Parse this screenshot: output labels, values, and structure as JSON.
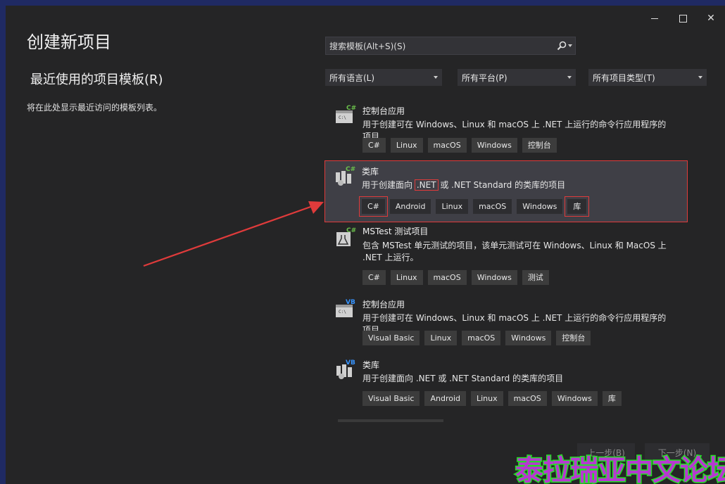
{
  "window": {
    "title": "创建新项目",
    "controls": {
      "minimize": "—",
      "maximize": "□",
      "close": "✕"
    }
  },
  "recent": {
    "heading": "最近使用的项目模板(R)",
    "empty_text": "将在此处显示最近访问的模板列表。"
  },
  "search": {
    "placeholder": "搜索模板(Alt+S)(S)",
    "icon": "search-icon"
  },
  "filters": {
    "language": "所有语言(L)",
    "platform": "所有平台(P)",
    "project_type": "所有项目类型(T)"
  },
  "templates": [
    {
      "badge": "C#",
      "icon": "console-app-icon",
      "name": "控制台应用",
      "desc": "用于创建可在 Windows、Linux 和 macOS 上 .NET 上运行的命令行应用程序的项目",
      "tags": [
        "C#",
        "Linux",
        "macOS",
        "Windows",
        "控制台"
      ]
    },
    {
      "badge": "C#",
      "icon": "class-library-icon",
      "name": "类库",
      "desc_a": "用于创建面向 ",
      "desc_hl": ".NET",
      "desc_b": " 或 .NET Standard 的类库的项目",
      "tags": [
        "C#",
        "Android",
        "Linux",
        "macOS",
        "Windows",
        "库"
      ],
      "selected": true
    },
    {
      "badge": "C#",
      "icon": "test-project-icon",
      "name": "MSTest 测试项目",
      "desc": "包含 MSTest 单元测试的项目，该单元测试可在 Windows、Linux 和 MacOS 上 .NET 上运行。",
      "tags": [
        "C#",
        "Linux",
        "macOS",
        "Windows",
        "测试"
      ]
    },
    {
      "badge": "VB",
      "icon": "console-app-icon",
      "name": "控制台应用",
      "desc": "用于创建可在 Windows、Linux 和 macOS 上 .NET 上运行的命令行应用程序的项目",
      "tags": [
        "Visual Basic",
        "Linux",
        "macOS",
        "Windows",
        "控制台"
      ]
    },
    {
      "badge": "VB",
      "icon": "class-library-icon",
      "name": "类库",
      "desc": "用于创建面向 .NET 或 .NET Standard 的类库的项目",
      "tags": [
        "Visual Basic",
        "Android",
        "Linux",
        "macOS",
        "Windows",
        "库"
      ]
    }
  ],
  "footer": {
    "back": "上一步(B)",
    "next": "下一步(N)"
  },
  "watermark": "泰拉瑞亚中文论坛",
  "colors": {
    "background": "#252526",
    "desktop": "#1f2a63",
    "annotation": "#e03b3b",
    "csharp_badge": "#6abf4b",
    "vb_badge": "#3794ff"
  }
}
